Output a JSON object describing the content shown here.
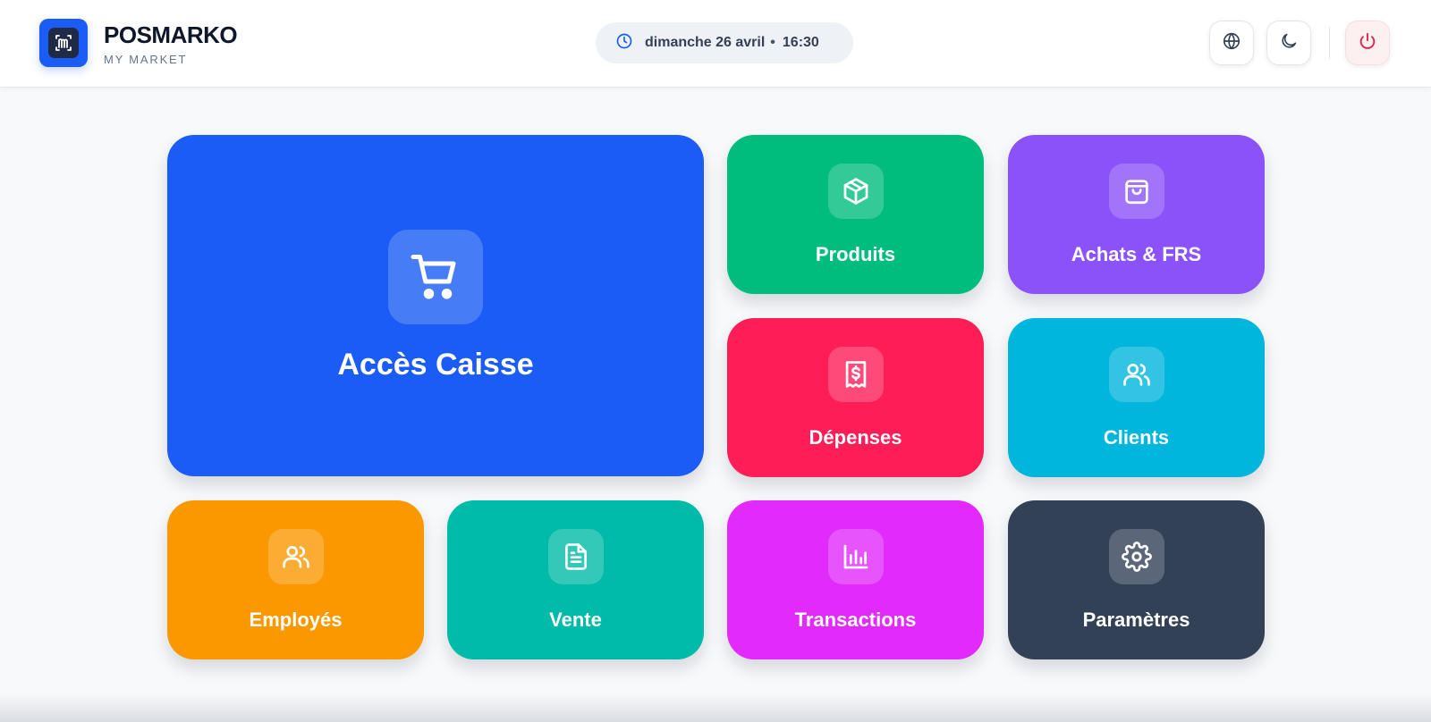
{
  "brand": {
    "title": "POSMARKO",
    "subtitle": "MY MARKET",
    "logo_icon": "market-logo-icon",
    "accent": "#1a5cf5"
  },
  "clock": {
    "icon": "clock-icon",
    "date": "dimanche 26 avril",
    "separator": "•",
    "time": "16:30"
  },
  "header_buttons": [
    {
      "name": "language",
      "icon": "globe-icon"
    },
    {
      "name": "theme",
      "icon": "moon-icon"
    },
    {
      "name": "logout",
      "icon": "power-icon",
      "color": "#e11d48"
    }
  ],
  "tiles": {
    "caisse": {
      "label": "Accès Caisse",
      "icon": "shopping-cart-icon",
      "color": "#1a5cf5"
    },
    "produits": {
      "label": "Produits",
      "icon": "box-icon",
      "color": "#00bd7e"
    },
    "achats": {
      "label": "Achats & FRS",
      "icon": "shopping-bag-icon",
      "color": "#8b52f9"
    },
    "depenses": {
      "label": "Dépenses",
      "icon": "receipt-icon",
      "color": "#fe1d57"
    },
    "clients": {
      "label": "Clients",
      "icon": "users-icon",
      "color": "#00b6dc"
    },
    "employes": {
      "label": "Employés",
      "icon": "users-icon",
      "color": "#fb9800"
    },
    "vente": {
      "label": "Vente",
      "icon": "document-icon",
      "color": "#00bba7"
    },
    "transactions": {
      "label": "Transactions",
      "icon": "bar-chart-icon",
      "color": "#e12afb"
    },
    "parametres": {
      "label": "Paramètres",
      "icon": "gear-icon",
      "color": "#334157"
    }
  }
}
